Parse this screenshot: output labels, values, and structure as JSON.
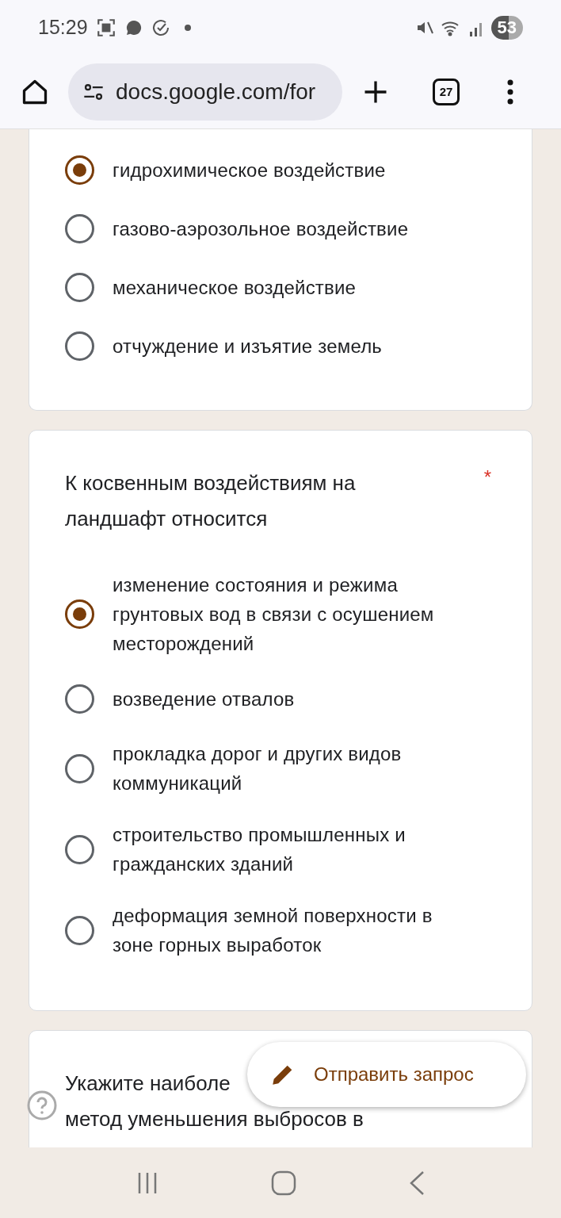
{
  "status_bar": {
    "time": "15:29",
    "battery": "53"
  },
  "browser": {
    "url": "docs.google.com/for",
    "tab_count": "27"
  },
  "questions": [
    {
      "options": [
        {
          "label": "гидрохимическое воздействие",
          "selected": true
        },
        {
          "label": "газово-аэрозольное воздействие",
          "selected": false
        },
        {
          "label": "механическое воздействие",
          "selected": false
        },
        {
          "label": "отчуждение и изъятие земель",
          "selected": false
        }
      ]
    },
    {
      "title_lines": [
        "К косвенным воздействиям на ландшафт относится"
      ],
      "required_mark": "*",
      "options": [
        {
          "label": "изменение состояния и режима грунтовых вод в связи с осушением месторождений",
          "selected": true
        },
        {
          "label": "возведение отвалов",
          "selected": false
        },
        {
          "label": "прокладка дорог и других видов коммуникаций",
          "selected": false
        },
        {
          "label": "строительство промышленных и гражданских зданий",
          "selected": false
        },
        {
          "label": "деформация земной поверхности в зоне горных выработок",
          "selected": false
        }
      ]
    },
    {
      "title_lines": [
        "Укажите наиболе",
        "метод уменьшения выбросов в"
      ]
    }
  ],
  "fab": {
    "label": "Отправить запрос"
  }
}
